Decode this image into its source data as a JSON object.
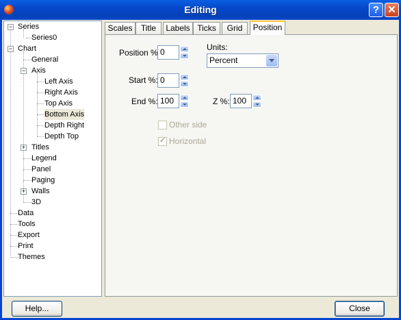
{
  "window": {
    "title": "Editing",
    "help_glyph": "?",
    "close_glyph": "✕"
  },
  "tree": {
    "series": "Series",
    "series0": "Series0",
    "chart": "Chart",
    "general": "General",
    "axis": "Axis",
    "left_axis": "Left Axis",
    "right_axis": "Right Axis",
    "top_axis": "Top Axis",
    "bottom_axis": "Bottom Axis",
    "depth_right": "Depth Right",
    "depth_top": "Depth Top",
    "titles": "Titles",
    "legend": "Legend",
    "panel": "Panel",
    "paging": "Paging",
    "walls": "Walls",
    "three_d": "3D",
    "data": "Data",
    "tools": "Tools",
    "export": "Export",
    "print": "Print",
    "themes": "Themes",
    "selected": "Bottom Axis"
  },
  "tabs": [
    "Scales",
    "Title",
    "Labels",
    "Ticks",
    "Grid",
    "Position"
  ],
  "active_tab": "Position",
  "position": {
    "position_label": "Position %:",
    "position_value": "0",
    "units_label": "Units:",
    "units_value": "Percent",
    "start_label": "Start %:",
    "start_value": "0",
    "end_label": "End %:",
    "end_value": "100",
    "z_label": "Z %:",
    "z_value": "100",
    "other_side_label": "Other side",
    "other_side_checked": false,
    "horizontal_label": "Horizontal",
    "horizontal_checked": true
  },
  "buttons": {
    "help": "Help...",
    "close": "Close"
  }
}
